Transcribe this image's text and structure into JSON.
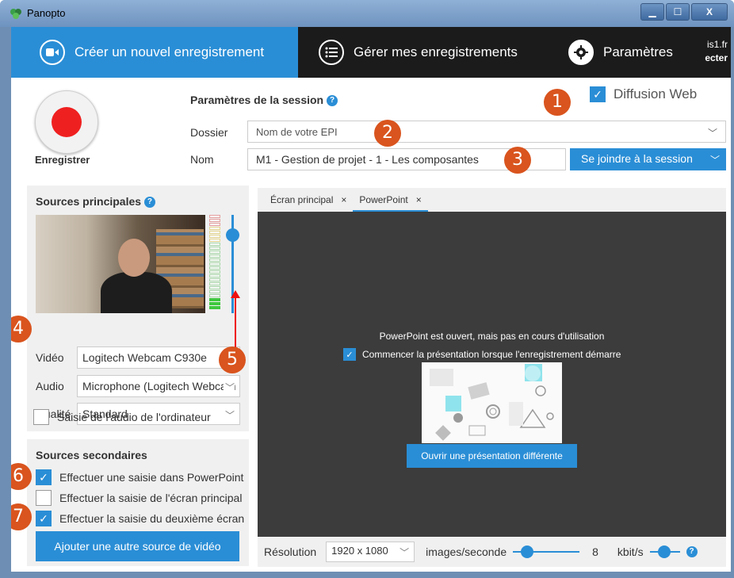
{
  "window": {
    "title": "Panopto",
    "min": "▁",
    "max": "☐",
    "close": "X"
  },
  "nav": {
    "create": "Créer un nouvel enregistrement",
    "manage": "Gérer mes enregistrements",
    "settings": "Paramètres",
    "user_line1": "is1.fr",
    "user_line2": "ecter"
  },
  "session": {
    "record_label": "Enregistrer",
    "title": "Paramètres de la session",
    "folder_label": "Dossier",
    "folder_value": "Nom de votre EPI",
    "name_label": "Nom",
    "name_value": "M1 - Gestion de projet - 1 - Les composantes",
    "join_label": "Se joindre à la session",
    "webcast_label": "Diffusion Web",
    "webcast_checked": true
  },
  "primary": {
    "title": "Sources principales",
    "video_label": "Vidéo",
    "video_value": "Logitech Webcam C930e",
    "audio_label": "Audio",
    "audio_value": "Microphone (Logitech Webcam",
    "quality_label": "Qualité",
    "quality_value": "Standard",
    "system_audio_label": "Saisie de l'audio de l'ordinateur"
  },
  "secondary": {
    "title": "Sources secondaires",
    "items": [
      {
        "label": "Effectuer une saisie dans PowerPoint",
        "checked": true
      },
      {
        "label": "Effectuer la saisie de l'écran principal",
        "checked": false
      },
      {
        "label": "Effectuer la saisie du deuxième écran",
        "checked": true
      }
    ],
    "add_video": "Ajouter une autre source de vidéo"
  },
  "preview": {
    "tabs": [
      {
        "label": "Écran principal",
        "close": "×"
      },
      {
        "label": "PowerPoint",
        "close": "×"
      }
    ],
    "message": "PowerPoint est ouvert, mais pas en cours d'utilisation",
    "start_option": "Commencer la présentation lorsque l'enregistrement démarre",
    "open_button": "Ouvrir une présentation différente",
    "resolution_label": "Résolution",
    "resolution_value": "1920 x 1080",
    "fps_label": "images/seconde",
    "fps_value": "8",
    "bitrate_label": "kbit/s"
  },
  "badges": [
    "1",
    "2",
    "3",
    "4",
    "5",
    "6",
    "7"
  ],
  "colors": {
    "accent": "#2a8ed6",
    "record": "#ef2020",
    "badge": "#d9541e",
    "nav_bg": "#1b1b1b",
    "stage_bg": "#3c3c3c"
  }
}
